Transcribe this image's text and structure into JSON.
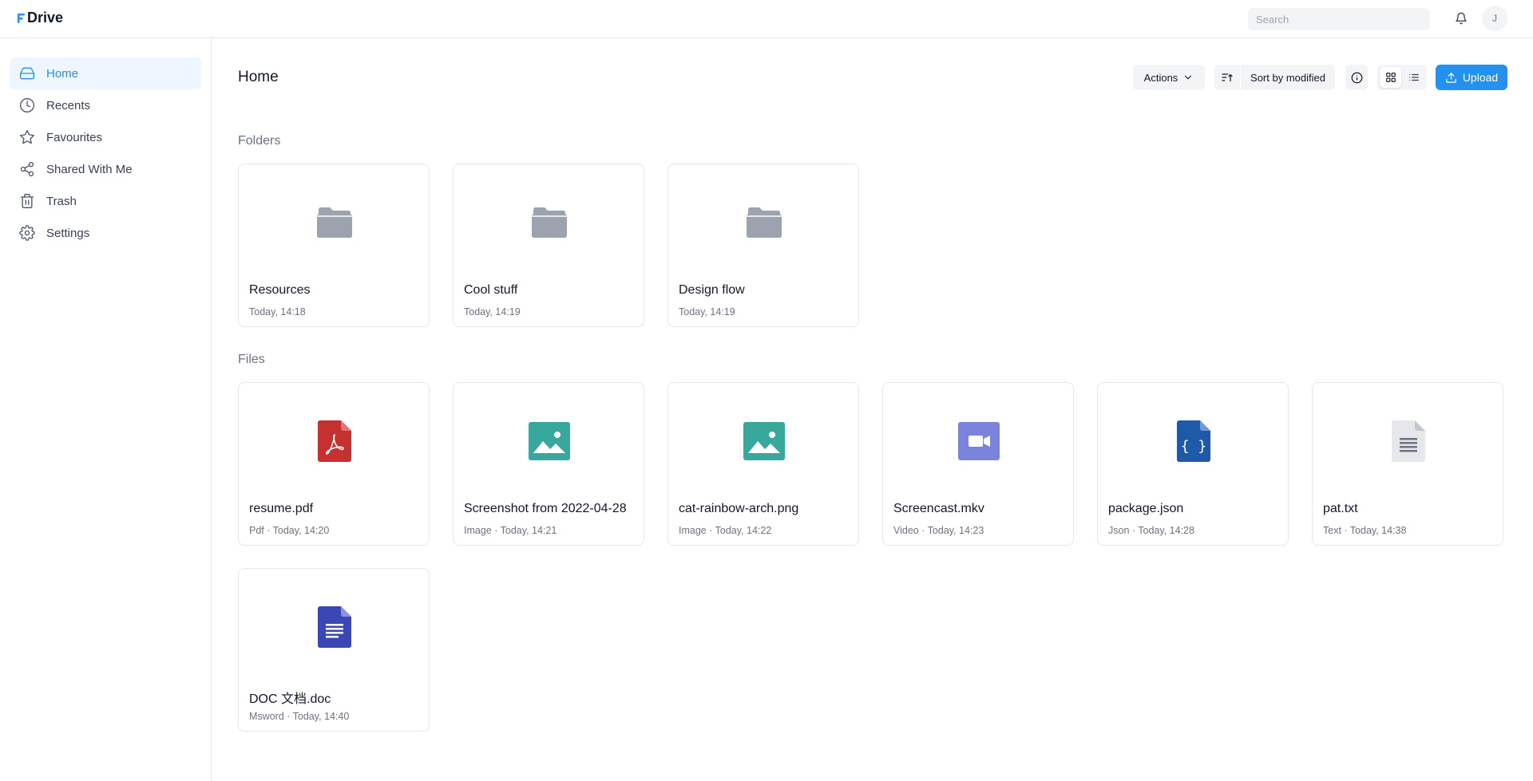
{
  "app": {
    "name": "Drive",
    "accent": "#2490ef"
  },
  "header": {
    "search_placeholder": "Search",
    "avatar_initial": "J"
  },
  "sidebar": {
    "items": [
      {
        "label": "Home",
        "icon": "drive-icon",
        "active": true
      },
      {
        "label": "Recents",
        "icon": "clock-icon"
      },
      {
        "label": "Favourites",
        "icon": "star-icon"
      },
      {
        "label": "Shared With Me",
        "icon": "share-icon"
      },
      {
        "label": "Trash",
        "icon": "trash-icon"
      },
      {
        "label": "Settings",
        "icon": "gear-icon"
      }
    ]
  },
  "main": {
    "title": "Home",
    "toolbar": {
      "actions_label": "Actions",
      "sort_label": "Sort by modified",
      "upload_label": "Upload"
    },
    "folders_title": "Folders",
    "files_title": "Files",
    "folders": [
      {
        "name": "Resources",
        "meta": "Today, 14:18"
      },
      {
        "name": "Cool stuff",
        "meta": "Today, 14:19"
      },
      {
        "name": "Design flow",
        "meta": "Today, 14:19"
      }
    ],
    "files": [
      {
        "name": "resume.pdf",
        "meta": "Pdf · Today, 14:20",
        "icon": "pdf-file-icon"
      },
      {
        "name": "Screenshot from 2022-04-28",
        "meta": "Image · Today, 14:21",
        "icon": "image-file-icon"
      },
      {
        "name": "cat-rainbow-arch.png",
        "meta": "Image · Today, 14:22",
        "icon": "image-file-icon"
      },
      {
        "name": "Screencast.mkv",
        "meta": "Video · Today, 14:23",
        "icon": "video-file-icon"
      },
      {
        "name": "package.json",
        "meta": "Json · Today, 14:28",
        "icon": "json-file-icon"
      },
      {
        "name": "pat.txt",
        "meta": "Text · Today, 14:38",
        "icon": "text-file-icon"
      },
      {
        "name": "DOC 文档.doc",
        "meta": "Msword · Today, 14:40",
        "icon": "doc-file-icon"
      }
    ]
  }
}
